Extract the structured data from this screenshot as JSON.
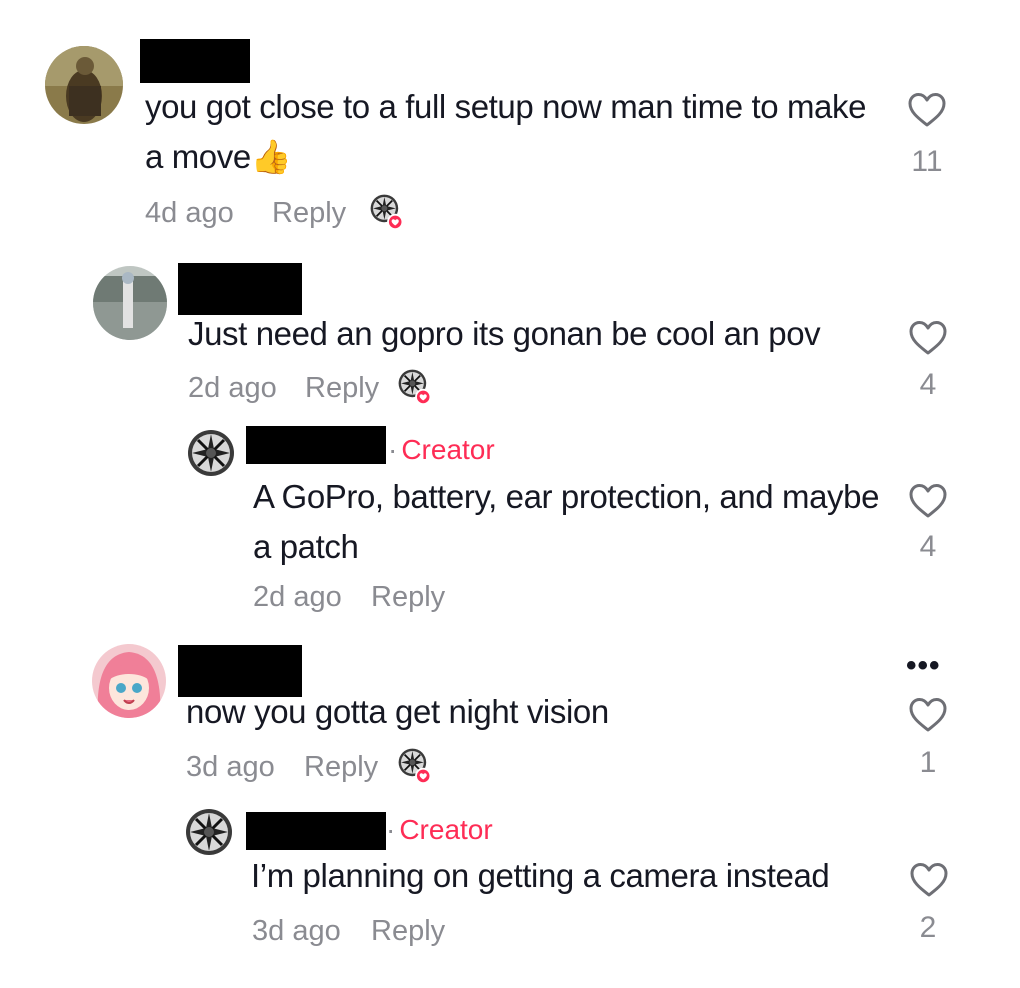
{
  "comments": [
    {
      "text": "you got close to a full setup now man time to make a move👍",
      "time": "4d ago",
      "reply_label": "Reply",
      "likes": "11",
      "liked_by_creator": true
    },
    {
      "text": "Just need an gopro its gonan be cool an pov",
      "time": "2d ago",
      "reply_label": "Reply",
      "likes": "4",
      "liked_by_creator": true
    },
    {
      "creator_label": "Creator",
      "creator_dot": "·",
      "text": "A GoPro, battery, ear protection, and maybe a patch",
      "time": "2d ago",
      "reply_label": "Reply",
      "likes": "4"
    },
    {
      "text": "now you gotta get night vision",
      "time": "3d ago",
      "reply_label": "Reply",
      "likes": "1",
      "liked_by_creator": true,
      "more_label": "•••"
    },
    {
      "creator_label": "Creator",
      "creator_dot": "·",
      "text": "I’m planning on getting a camera instead",
      "time": "3d ago",
      "reply_label": "Reply",
      "likes": "2"
    }
  ],
  "colors": {
    "accent": "#fe2c55",
    "muted": "#8a8b91",
    "text": "#161823",
    "redaction": "#000000"
  },
  "icons": {
    "like": "heart-outline-icon",
    "creator_liked": "creator-liked-badge-icon",
    "more": "more-horizontal-icon"
  }
}
